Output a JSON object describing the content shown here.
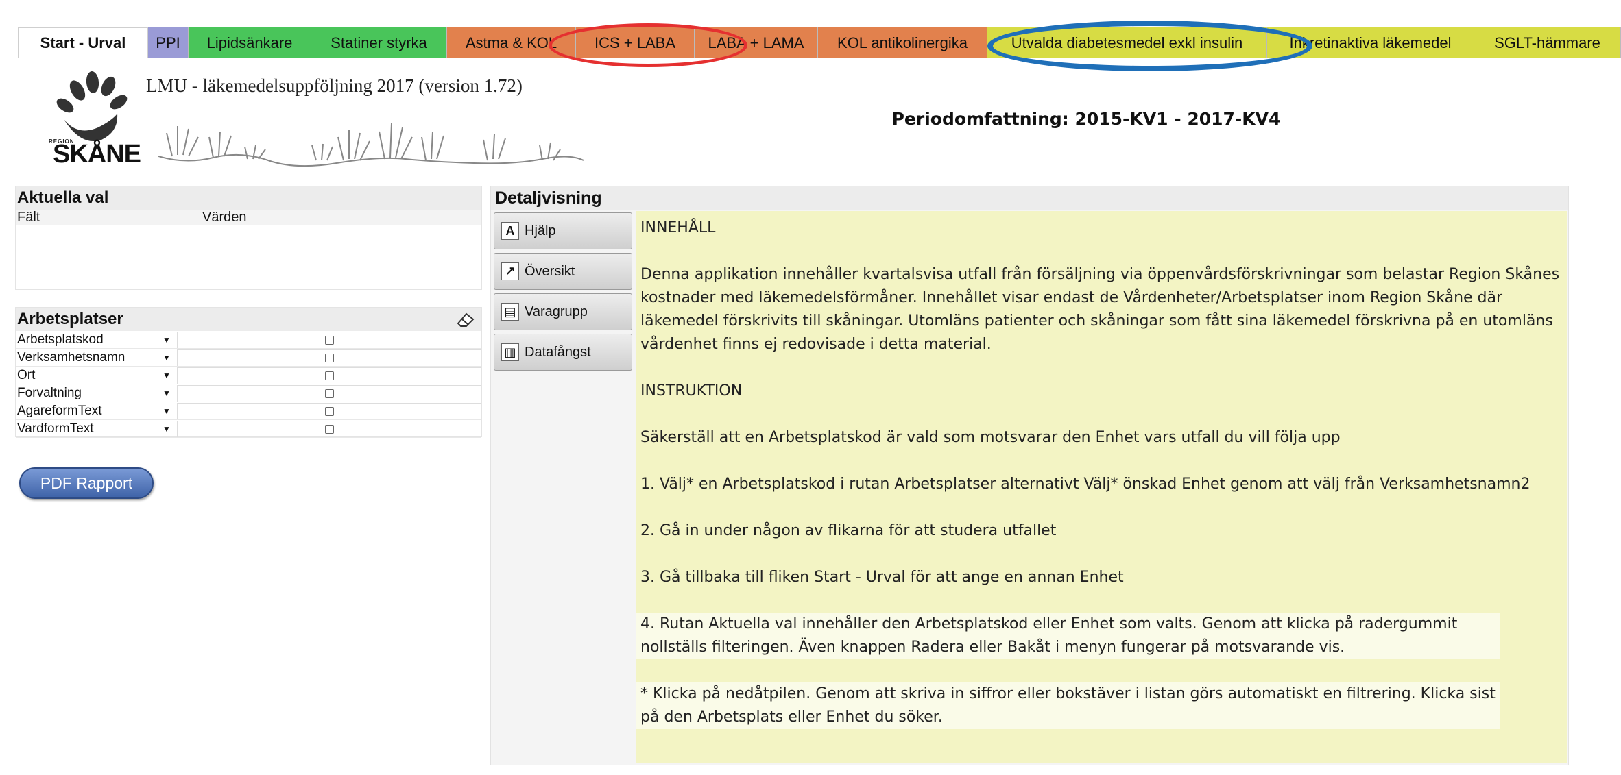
{
  "tabs": [
    {
      "label": "Start - Urval",
      "color": "#ffffff",
      "width": 190,
      "active": true
    },
    {
      "label": "PPI",
      "color": "#9a9bd6",
      "width": 59
    },
    {
      "label": "Lipidsänkare",
      "color": "#49c55a",
      "width": 179
    },
    {
      "label": "Statiner styrka",
      "color": "#49c55a",
      "width": 198
    },
    {
      "label": "Astma & KOL",
      "color": "#e2814d",
      "width": 188
    },
    {
      "label": "ICS + LABA",
      "color": "#e2814d",
      "width": 173
    },
    {
      "label": "LABA + LAMA",
      "color": "#e2814d",
      "width": 180
    },
    {
      "label": "KOL antikolinergika",
      "color": "#e2814d",
      "width": 247
    },
    {
      "label": "Utvalda diabetesmedel exkl insulin",
      "color": "#d7dc44",
      "width": 408
    },
    {
      "label": "Inkretinaktiva läkemedel",
      "color": "#d7dc44",
      "width": 302
    },
    {
      "label": "SGLT-hämmare",
      "color": "#d7dc44",
      "width": 214
    }
  ],
  "header": {
    "logo_text": "SKÅNE",
    "logo_small": "REGION",
    "app_title": "LMU - läkemedelsuppföljning 2017 (version 1.72)",
    "period_label": "Periodomfattning:  2015-KV1 - 2017-KV4"
  },
  "aktuella": {
    "title": "Aktuella val",
    "col_field": "Fält",
    "col_values": "Värden"
  },
  "arbetsplatser": {
    "title": "Arbetsplatser",
    "filters": [
      "Arbetsplatskod",
      "Verksamhetsnamn",
      "Ort",
      "Forvaltning",
      "AgareformText",
      "VardformText"
    ]
  },
  "pdf_button": "PDF Rapport",
  "detail": {
    "title": "Detaljvisning",
    "buttons": [
      {
        "label": "Hjälp",
        "icon": "help-icon",
        "glyph": "A"
      },
      {
        "label": "Översikt",
        "icon": "chart-line-icon",
        "glyph": "↗"
      },
      {
        "label": "Varagrupp",
        "icon": "window-icon",
        "glyph": "▤"
      },
      {
        "label": "Datafångst",
        "icon": "table-icon",
        "glyph": "▥"
      }
    ],
    "paragraphs": [
      "INNEHÅLL",
      "Denna applikation innehåller kvartalsvisa utfall från försäljning via öppenvårdsförskrivningar som belastar Region Skånes kostnader med läkemedelsförmåner. Innehållet visar endast de Vårdenheter/Arbetsplatser inom Region Skåne där läkemedel förskrivits till skåningar. Utomläns patienter och skåningar som fått sina läkemedel förskrivna på en utomläns vårdenhet finns ej redovisade i detta material.",
      "INSTRUKTION",
      "Säkerställ att en Arbetsplatskod är vald som motsvarar den Enhet vars utfall du vill följa upp",
      "1. Välj* en Arbetsplatskod i rutan Arbetsplatser alternativt Välj* önskad Enhet genom att välj från Verksamhetsnamn2",
      "2. Gå in under någon av flikarna för att studera utfallet",
      "3. Gå tillbaka till fliken Start - Urval för att ange en annan Enhet",
      "4. Rutan Aktuella val innehåller den Arbetsplatskod eller Enhet som valts. Genom att klicka på radergummit nollställs filteringen. Även knappen Radera eller Bakåt i menyn fungerar på motsvarande vis.",
      "* Klicka på nedåtpilen. Genom att skriva in siffror eller bokstäver i listan görs automatiskt en filtrering. Klicka sist på den Arbetsplats eller Enhet du söker."
    ]
  },
  "colors": {
    "highlight_red": "#e53030",
    "highlight_blue": "#1f6fb8",
    "content_bg": "#f3f4c4"
  }
}
